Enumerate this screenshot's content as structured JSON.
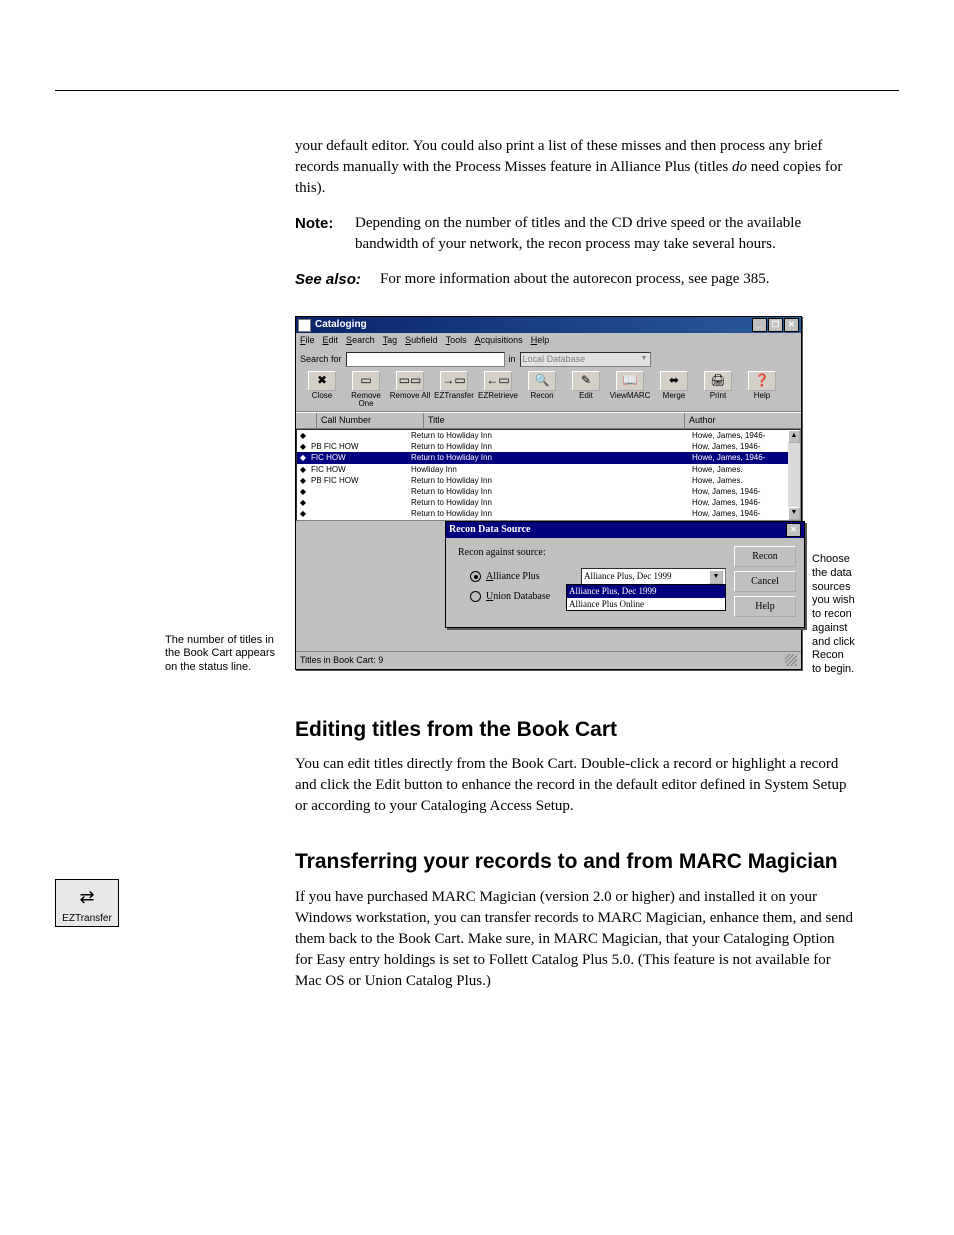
{
  "intro": {
    "p1a": "your default editor.  You could also print a list of these misses and then process any brief records manually with the Process Misses feature in Alliance Plus (titles ",
    "p1_em": "do",
    "p1b": " need copies for this)."
  },
  "note": {
    "label": "Note:",
    "text": "Depending on the number of titles and the CD drive speed or the available bandwidth of your network, the recon process may take several hours."
  },
  "see": {
    "label": "See also:",
    "text": "For more information about the autorecon process, see page 385."
  },
  "captions": {
    "left": "The number of titles in the Book Cart appears on the status line.",
    "right": "Choose the data sources you wish to recon against and click Recon to begin."
  },
  "window": {
    "title": "Cataloging",
    "menus": [
      "File",
      "Edit",
      "Search",
      "Tag",
      "Subfield",
      "Tools",
      "Acquisitions",
      "Help"
    ],
    "search_label": "Search for",
    "in_label": "in",
    "in_value": "Local Database",
    "buttons": [
      "Close",
      "Remove One",
      "Remove All",
      "EZTransfer",
      "EZRetrieve",
      "Recon",
      "Edit",
      "ViewMARC",
      "Merge",
      "Print",
      "Help"
    ],
    "cols": [
      "Call Number",
      "Title",
      "Author"
    ],
    "rows": [
      {
        "call": "",
        "title": "Return to Howliday Inn",
        "author": "Howe, James, 1946-",
        "sel": false
      },
      {
        "call": "PB FIC HOW",
        "title": "Return to Howliday Inn",
        "author": "How, James, 1946-",
        "sel": false
      },
      {
        "call": "FIC HOW",
        "title": "Return to Howliday Inn",
        "author": "Howe, James, 1946-",
        "sel": true
      },
      {
        "call": "FIC HOW",
        "title": "Howliday Inn",
        "author": "Howe, James.",
        "sel": false
      },
      {
        "call": "PB FIC HOW",
        "title": "Return to Howliday Inn",
        "author": "Howe, James.",
        "sel": false
      },
      {
        "call": "",
        "title": "Return to Howliday Inn",
        "author": "How, James, 1946-",
        "sel": false
      },
      {
        "call": "",
        "title": "Return to Howliday Inn",
        "author": "How, James, 1946-",
        "sel": false
      },
      {
        "call": "",
        "title": "Return to Howliday Inn",
        "author": "How, James, 1946-",
        "sel": false
      },
      {
        "call": "",
        "title": "Return to Howliday Inn",
        "author": "How, James, 1946-",
        "sel": false
      }
    ],
    "status": "Titles in Book Cart:  9"
  },
  "dialog": {
    "title": "Recon Data Source",
    "prompt": "Recon against source:",
    "opt1_label": "Alliance Plus",
    "opt1_value": "Alliance Plus, Dec 1999",
    "opt2_label": "Union Database",
    "dropdown": [
      "Alliance Plus, Dec 1999",
      "Alliance Plus Online"
    ],
    "btns": [
      "Recon",
      "Cancel",
      "Help"
    ]
  },
  "sec1": {
    "h": "Editing titles from the Book Cart",
    "p": "You can edit titles directly from the Book Cart. Double-click a record or highlight a record and click the Edit button to enhance the record in the default editor defined in System Setup or according to your Cataloging Access Setup."
  },
  "sec2": {
    "h": "Transferring your records to and from MARC Magician",
    "p": "If you have purchased MARC Magician (version 2.0 or higher) and installed it on your Windows workstation, you can transfer records to MARC Magician, enhance them, and send them back to the Book Cart. Make sure, in MARC Magician, that your Cataloging Option for Easy entry holdings is set to Follett Catalog Plus 5.0. (This feature is not available for Mac OS or Union Catalog Plus.)"
  },
  "ez_label": "EZTransfer"
}
